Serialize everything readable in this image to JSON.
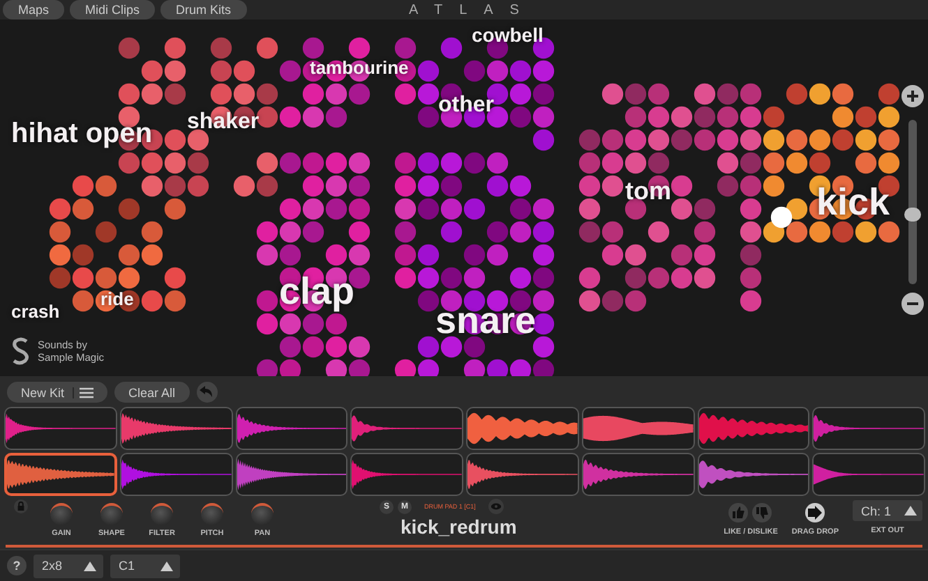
{
  "top_bar": {
    "tabs": [
      {
        "label": "Maps"
      },
      {
        "label": "Midi Clips"
      },
      {
        "label": "Drum Kits"
      }
    ],
    "title": "ATLAS"
  },
  "map": {
    "labels": [
      {
        "text": "cowbell"
      },
      {
        "text": "tambourine"
      },
      {
        "text": "other"
      },
      {
        "text": "shaker"
      },
      {
        "text": "hihat open"
      },
      {
        "text": "tom"
      },
      {
        "text": "kick"
      },
      {
        "text": "crash"
      },
      {
        "text": "ride"
      },
      {
        "text": "clap"
      },
      {
        "text": "snare"
      }
    ],
    "credit": "Sounds by Sample Magic"
  },
  "kit_toolbar": {
    "buttons": [
      "New Kit",
      "Clear All"
    ]
  },
  "pads": [
    {
      "color": "#e0208a",
      "selected": false
    },
    {
      "color": "#e83a6a",
      "selected": false
    },
    {
      "color": "#d020b0",
      "selected": false
    },
    {
      "color": "#e0207a",
      "selected": false
    },
    {
      "color": "#f06040",
      "selected": false
    },
    {
      "color": "#e84860",
      "selected": false
    },
    {
      "color": "#e0104a",
      "selected": false
    },
    {
      "color": "#d020a0",
      "selected": false
    },
    {
      "color": "#e06040",
      "selected": true
    },
    {
      "color": "#b010e0",
      "selected": false
    },
    {
      "color": "#c040c0",
      "selected": false
    },
    {
      "color": "#e01070",
      "selected": false
    },
    {
      "color": "#e85060",
      "selected": false
    },
    {
      "color": "#d030a0",
      "selected": false
    },
    {
      "color": "#c050c0",
      "selected": false
    },
    {
      "color": "#d020a0",
      "selected": false
    }
  ],
  "knobs": [
    {
      "label": "GAIN"
    },
    {
      "label": "SHAPE"
    },
    {
      "label": "FILTER"
    },
    {
      "label": "PITCH"
    },
    {
      "label": "PAN"
    }
  ],
  "solo": "S",
  "mute": "M",
  "pad_info": "DRUM PAD 1 [C1]",
  "sample_name": "kick_redrum",
  "like_label": "LIKE / DISLIKE",
  "drag_label": "DRAG DROP",
  "channel": "Ch: 1",
  "ext_label": "EXT OUT",
  "footer": {
    "help": "?",
    "layout": "2x8",
    "note": "C1"
  }
}
